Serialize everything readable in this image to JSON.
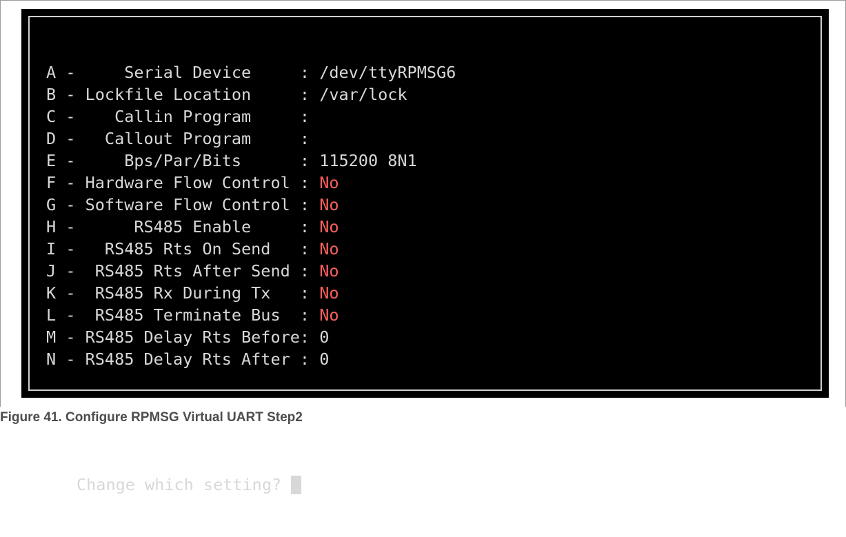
{
  "terminal": {
    "rows": [
      {
        "key": "A",
        "sep": "-",
        "label": "    Serial Device    ",
        "colon": ":",
        "value": " /dev/ttyRPMSG6",
        "value_no": ""
      },
      {
        "key": "B",
        "sep": "-",
        "label": "Lockfile Location    ",
        "colon": ":",
        "value": " /var/lock",
        "value_no": ""
      },
      {
        "key": "C",
        "sep": "-",
        "label": "   Callin Program    ",
        "colon": ":",
        "value": "",
        "value_no": ""
      },
      {
        "key": "D",
        "sep": "-",
        "label": "  Callout Program    ",
        "colon": ":",
        "value": "",
        "value_no": ""
      },
      {
        "key": "E",
        "sep": "-",
        "label": "    Bps/Par/Bits     ",
        "colon": ":",
        "value": " 115200 8N1",
        "value_no": ""
      },
      {
        "key": "F",
        "sep": "-",
        "label": "Hardware Flow Control",
        "colon": ":",
        "value": "",
        "value_no": " No"
      },
      {
        "key": "G",
        "sep": "-",
        "label": "Software Flow Control",
        "colon": ":",
        "value": "",
        "value_no": " No"
      },
      {
        "key": "H",
        "sep": "-",
        "label": "     RS485 Enable    ",
        "colon": ":",
        "value": "",
        "value_no": " No"
      },
      {
        "key": "I",
        "sep": "-",
        "label": "  RS485 Rts On Send  ",
        "colon": ":",
        "value": "",
        "value_no": " No"
      },
      {
        "key": "J",
        "sep": "-",
        "label": " RS485 Rts After Send",
        "colon": ":",
        "value": "",
        "value_no": " No"
      },
      {
        "key": "K",
        "sep": "-",
        "label": " RS485 Rx During Tx  ",
        "colon": ":",
        "value": "",
        "value_no": " No"
      },
      {
        "key": "L",
        "sep": "-",
        "label": " RS485 Terminate Bus ",
        "colon": ":",
        "value": "",
        "value_no": " No"
      },
      {
        "key": "M",
        "sep": "-",
        "label": "RS485 Delay Rts Before",
        "colon": ":",
        "value": " 0",
        "value_no": ""
      },
      {
        "key": "N",
        "sep": "-",
        "label": "RS485 Delay Rts After ",
        "colon": ":",
        "value": " 0",
        "value_no": ""
      }
    ],
    "prompt": "Change which setting?"
  },
  "caption": {
    "text": "Figure 41.  Configure RPMSG Virtual UART Step2"
  },
  "colors": {
    "terminal_bg": "#000000",
    "terminal_text": "#d8d8d8",
    "value_no": "#ff5f5f",
    "caption": "#4d4d4d"
  }
}
